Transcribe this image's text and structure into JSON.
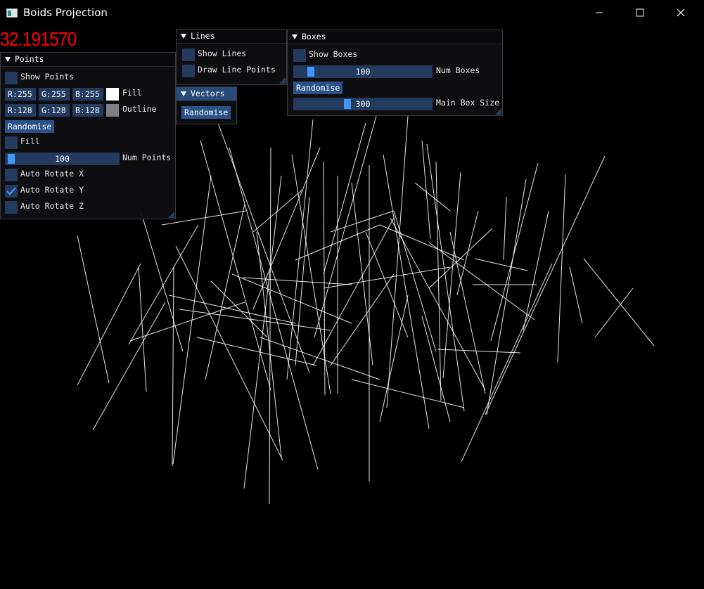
{
  "window": {
    "title": "Boids Projection",
    "icon": "app-window-icon",
    "controls": [
      "minimize-icon",
      "maximize-icon",
      "close-icon"
    ]
  },
  "fps": "32.191570",
  "points_panel": {
    "header": "Points",
    "show_points_label": "Show Points",
    "show_points_checked": false,
    "fill_color": {
      "r": "R:255",
      "g": "G:255",
      "b": "B:255",
      "label": "Fill",
      "swatch": "#ffffff"
    },
    "outline_color": {
      "r": "R:128",
      "g": "G:128",
      "b": "B:128",
      "label": "Outline",
      "swatch": "#808080"
    },
    "randomise_label": "Randomise",
    "fill_label": "Fill",
    "fill_checked": false,
    "num_points": {
      "value": "100",
      "label": "Num Points",
      "fraction": 0.0
    },
    "auto_rotate_x_label": "Auto Rotate X",
    "auto_rotate_x_checked": false,
    "auto_rotate_y_label": "Auto Rotate Y",
    "auto_rotate_y_checked": true,
    "auto_rotate_z_label": "Auto Rotate Z",
    "auto_rotate_z_checked": false
  },
  "lines_panel": {
    "header": "Lines",
    "show_lines_label": "Show Lines",
    "show_lines_checked": false,
    "draw_line_points_label": "Draw Line Points",
    "draw_line_points_checked": false
  },
  "vectors_panel": {
    "header": "Vectors",
    "randomise_label": "Randomise"
  },
  "boxes_panel": {
    "header": "Boxes",
    "show_boxes_label": "Show Boxes",
    "show_boxes_checked": false,
    "num_boxes": {
      "value": "100",
      "label": "Num Boxes",
      "fraction": 0.1
    },
    "randomise_label": "Randomise",
    "main_box_size": {
      "value": "300",
      "label": "Main Box Size",
      "fraction": 0.4
    }
  },
  "colors": {
    "background": "#000000",
    "fps_text": "#ff0000",
    "lines": "#ffffff",
    "widget_bg": "#243a5e",
    "button_bg": "#2a5288",
    "slider_grab": "#4296fa"
  }
}
